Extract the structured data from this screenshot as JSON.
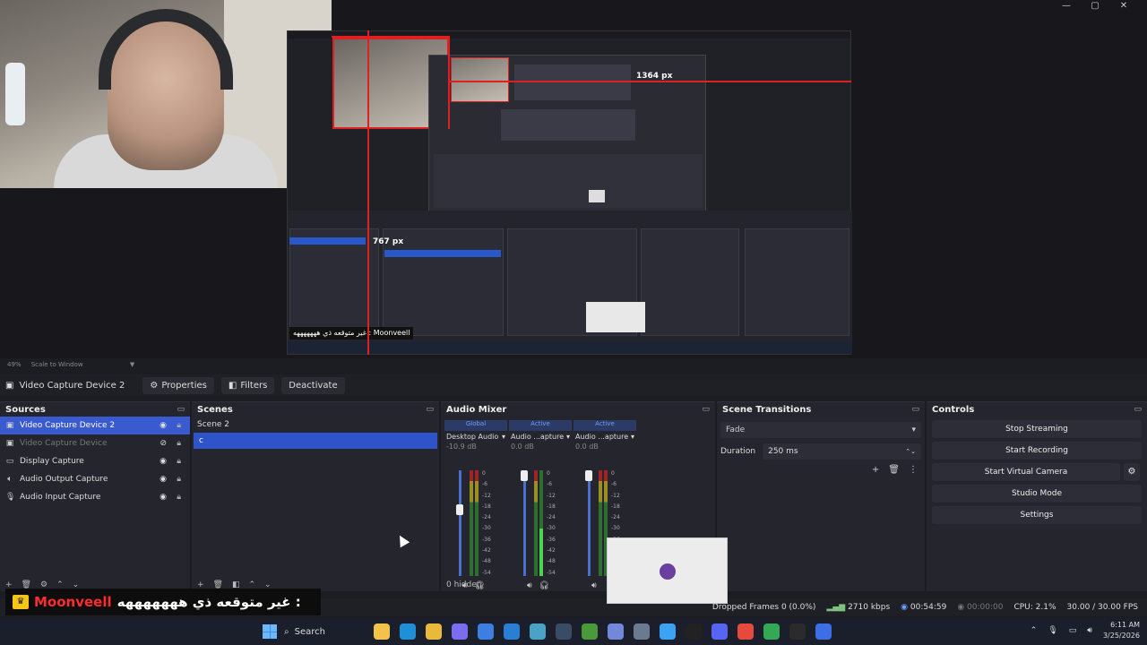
{
  "preview": {
    "width_label": "1364 px",
    "height_label": "767 px",
    "nested_ticker": "غير متوقعه ذي هههههههه : Moonveell"
  },
  "zoom": {
    "level": "49%",
    "mode": "Scale to Window"
  },
  "toolbar": {
    "source_name": "Video Capture Device 2",
    "properties": "Properties",
    "filters": "Filters",
    "deactivate": "Deactivate"
  },
  "sources": {
    "title": "Sources",
    "items": [
      {
        "label": "Video Capture Device 2",
        "icon": "camera-icon"
      },
      {
        "label": "Video Capture Device",
        "icon": "camera-icon"
      },
      {
        "label": "Display Capture",
        "icon": "monitor-icon"
      },
      {
        "label": "Audio Output Capture",
        "icon": "speaker-icon"
      },
      {
        "label": "Audio Input Capture",
        "icon": "microphone-icon"
      }
    ]
  },
  "scenes": {
    "title": "Scenes",
    "items": [
      "Scene 2",
      "c"
    ]
  },
  "mixer": {
    "title": "Audio Mixer",
    "channels": [
      {
        "tag": "Global",
        "name": "Desktop Audio",
        "db": "-10.9 dB"
      },
      {
        "tag": "Active",
        "name": "Audio ...apture",
        "db": "0.0 dB"
      },
      {
        "tag": "Active",
        "name": "Audio ...apture",
        "db": "0.0 dB"
      }
    ],
    "scale": [
      "0",
      "-6",
      "-12",
      "-18",
      "-24",
      "-30",
      "-36",
      "-42",
      "-48",
      "-54",
      "-60"
    ],
    "hidden": "0 hidden"
  },
  "transitions": {
    "title": "Scene Transitions",
    "type": "Fade",
    "duration_label": "Duration",
    "duration_value": "250 ms"
  },
  "controls": {
    "title": "Controls",
    "buttons": [
      "Stop Streaming",
      "Start Recording",
      "Start Virtual Camera",
      "Studio Mode",
      "Settings"
    ]
  },
  "status": {
    "dropped": "Dropped Frames 0 (0.0%)",
    "bitrate": "2710 kbps",
    "stream_time": "00:54:59",
    "rec_time": "00:00:00",
    "cpu": "CPU: 2.1%",
    "fps": "30.00 / 30.00 FPS"
  },
  "overlay": {
    "username": "Moonveell",
    "message": "غير متوقعه ذي هههههههه :"
  },
  "taskbar": {
    "search": "Search",
    "time": "6:11 AM",
    "date": "3/25/2026",
    "apps": [
      {
        "name": "file-explorer-icon",
        "color": "#f2c34a"
      },
      {
        "name": "edge-icon",
        "color": "#1f8fd6"
      },
      {
        "name": "folder-icon",
        "color": "#e9b93c"
      },
      {
        "name": "copilot-icon",
        "color": "#7b6cf0"
      },
      {
        "name": "store-icon",
        "color": "#3d7ee3"
      },
      {
        "name": "vscode-icon",
        "color": "#2a7fd4"
      },
      {
        "name": "wireless-icon",
        "color": "#4aa3c6"
      },
      {
        "name": "steam-icon",
        "color": "#3a4b66"
      },
      {
        "name": "minecraft-icon",
        "color": "#4a9a3a"
      },
      {
        "name": "discord-icon",
        "color": "#7289da"
      },
      {
        "name": "settings-icon",
        "color": "#6a7a90"
      },
      {
        "name": "messenger-icon",
        "color": "#3ba3f2"
      },
      {
        "name": "tiktok-icon",
        "color": "#222222"
      },
      {
        "name": "discord2-icon",
        "color": "#5865f2"
      },
      {
        "name": "chrome-icon",
        "color": "#e64a3c"
      },
      {
        "name": "chrome2-icon",
        "color": "#34a853"
      },
      {
        "name": "obs-icon",
        "color": "#2b2b2b"
      },
      {
        "name": "app-icon",
        "color": "#3d6ee3"
      }
    ]
  }
}
